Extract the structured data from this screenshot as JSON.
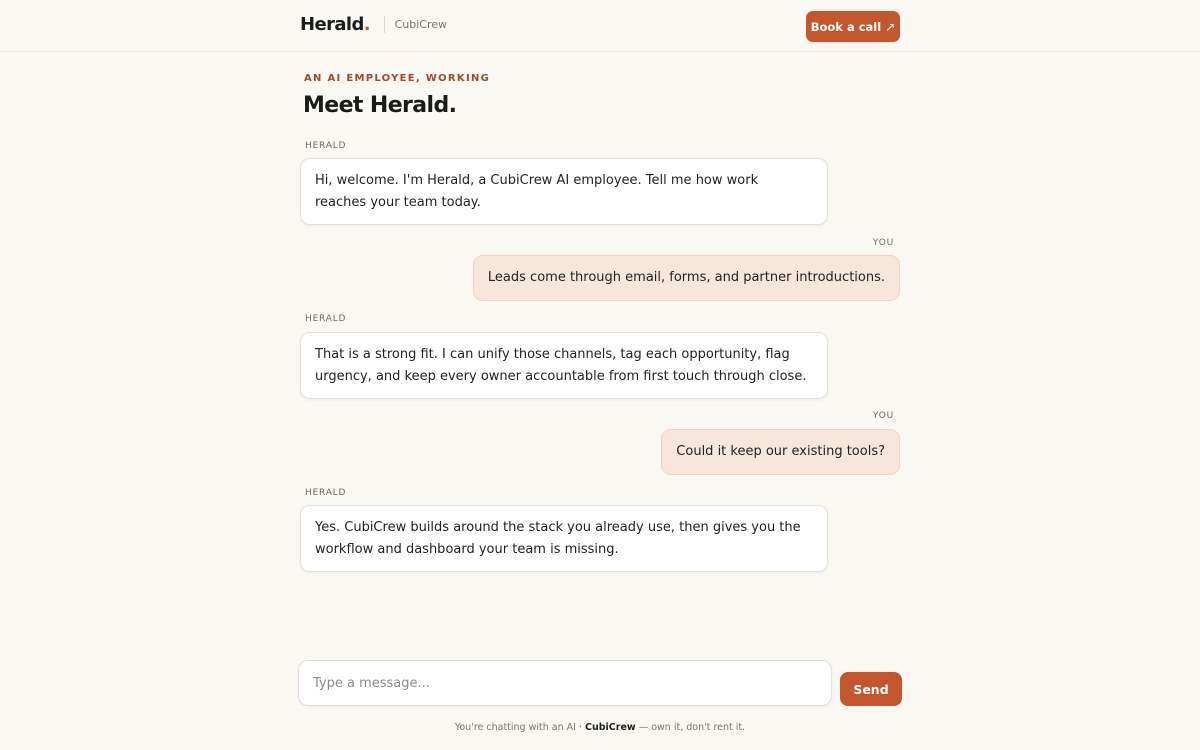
{
  "header": {
    "brand_name": "Herald",
    "brand_dot": ".",
    "brand_sub": "CubiCrew",
    "book_label": "Book a call",
    "book_icon": "↗"
  },
  "hero": {
    "kicker": "AN AI EMPLOYEE, WORKING",
    "title": "Meet Herald."
  },
  "messages": [
    {
      "sender": "HERALD",
      "text": "Hi, welcome. I'm Herald, a CubiCrew AI employee. Tell me how work reaches your team today."
    },
    {
      "sender": "YOU",
      "text": "Leads come through email, forms, and partner introductions."
    },
    {
      "sender": "HERALD",
      "text": "That is a strong fit. I can unify those channels, tag each opportunity, flag urgency, and keep every owner accountable from first touch through close."
    },
    {
      "sender": "YOU",
      "text": "Could it keep our existing tools?"
    },
    {
      "sender": "HERALD",
      "text": "Yes. CubiCrew builds around the stack you already use, then gives you the workflow and dashboard your team is missing."
    }
  ],
  "composer": {
    "placeholder": "Type a message...",
    "value": "",
    "send_label": "Send"
  },
  "footer": {
    "prefix": "You're chatting with an AI · ",
    "brand": "CubiCrew",
    "suffix": " — own it, don't rent it."
  },
  "colors": {
    "accent": "#c4562d",
    "background": "#faf8f3",
    "user_bubble": "#f8e6da"
  }
}
